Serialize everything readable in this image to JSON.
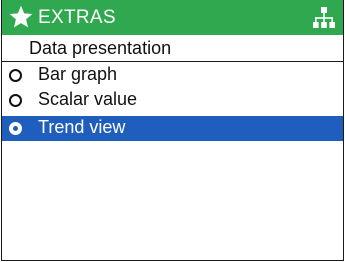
{
  "header": {
    "title": "EXTRAS",
    "background_color": "#2fa84f",
    "left_icon": "star-icon",
    "right_icon": "hierarchy-icon"
  },
  "subheader": {
    "title": "Data presentation"
  },
  "options": [
    {
      "label": "Bar graph",
      "selected": false
    },
    {
      "label": "Scalar value",
      "selected": false
    },
    {
      "label": "Trend view",
      "selected": true
    }
  ],
  "selection_color": "#1f5ebd"
}
